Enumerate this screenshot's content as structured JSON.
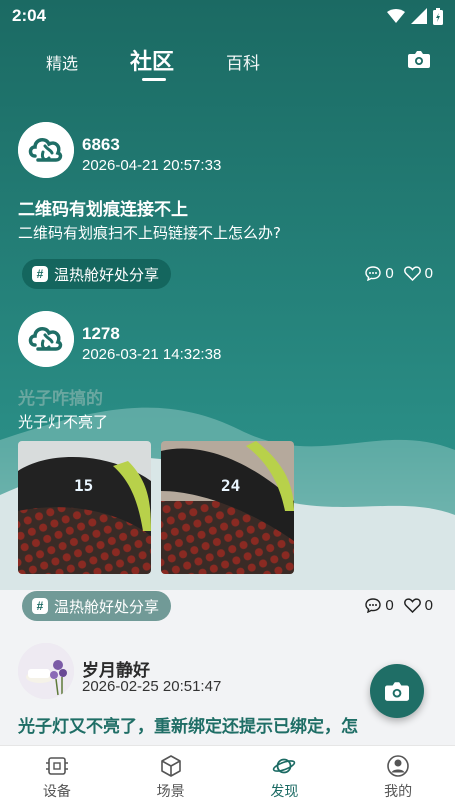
{
  "status_bar": {
    "time": "2:04"
  },
  "top_tabs": [
    {
      "label": "精选"
    },
    {
      "label": "社区",
      "active": true
    },
    {
      "label": "百科"
    }
  ],
  "posts": [
    {
      "username": "6863",
      "date": "2026-04-21 20:57:33",
      "title": "二维码有划痕连接不上",
      "body": "二维码有划痕扫不上码链接不上怎么办?",
      "tag": "温热舱好处分享",
      "comments": "0",
      "likes": "0"
    },
    {
      "username": "1278",
      "date": "2026-03-21 14:32:38",
      "title": "光子咋搞的",
      "body": "光子灯不亮了",
      "photos": [
        {
          "display": "15",
          "alt": "device-photo"
        },
        {
          "display": "24",
          "alt": "device-photo"
        }
      ],
      "tag": "温热舱好处分享",
      "comments": "0",
      "likes": "0"
    },
    {
      "username": "岁月静好",
      "date": "2026-02-25 20:51:47",
      "title": "光子灯又不亮了，重新绑定还提示已绑定，怎"
    }
  ],
  "bottom_nav": [
    {
      "label": "设备",
      "icon": "device-icon"
    },
    {
      "label": "场景",
      "icon": "cube-icon"
    },
    {
      "label": "发现",
      "icon": "planet-icon",
      "active": true
    },
    {
      "label": "我的",
      "icon": "profile-icon"
    }
  ],
  "colors": {
    "primary": "#1b6a63",
    "accent": "#2a8e86"
  }
}
